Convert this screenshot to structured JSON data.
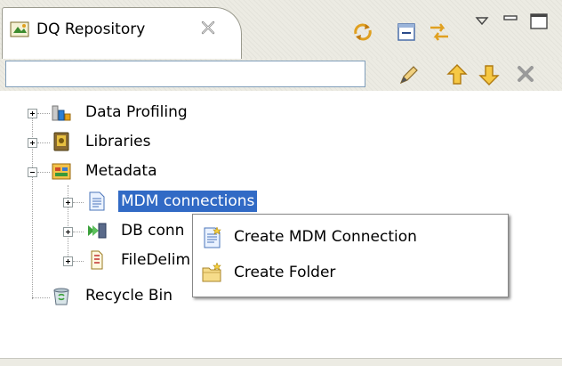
{
  "view": {
    "tab_title": "DQ Repository"
  },
  "filter": {
    "value": "",
    "placeholder": ""
  },
  "tree": {
    "items": [
      {
        "label": "Data Profiling"
      },
      {
        "label": "Libraries"
      },
      {
        "label": "Metadata"
      },
      {
        "label": "MDM connections"
      },
      {
        "label": "DB conn"
      },
      {
        "label": "FileDelim"
      },
      {
        "label": "Recycle Bin"
      }
    ]
  },
  "context_menu": {
    "items": [
      {
        "label": "Create MDM Connection"
      },
      {
        "label": "Create Folder"
      }
    ]
  },
  "colors": {
    "selection": "#316ac5",
    "toolbar_bg": "#ecebe3"
  }
}
